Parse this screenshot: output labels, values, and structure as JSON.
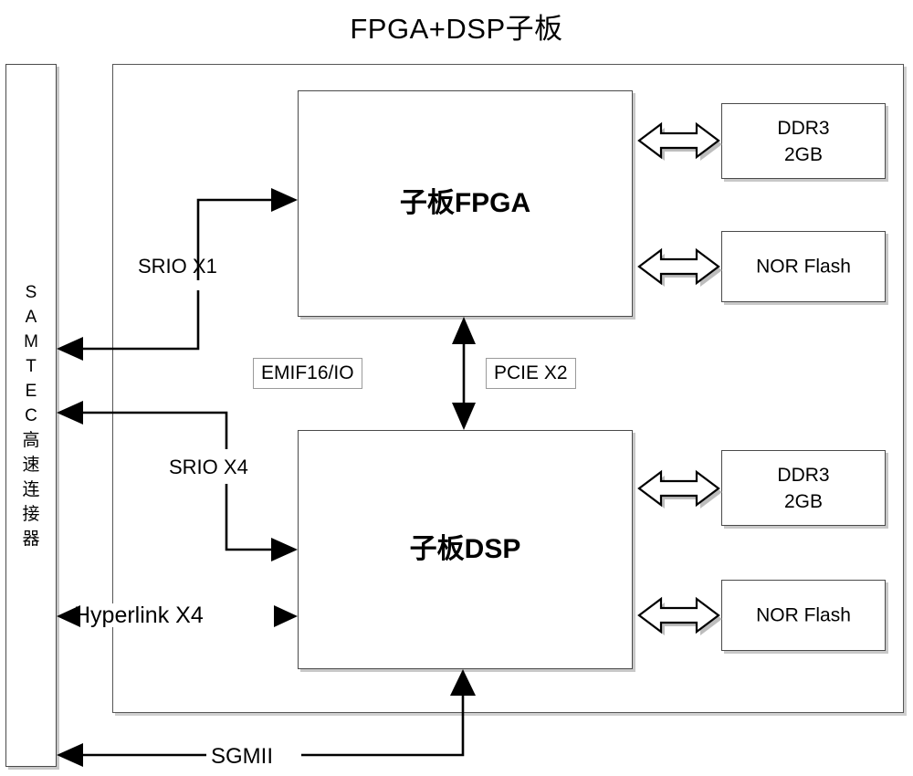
{
  "title": "FPGA+DSP子板",
  "connector": {
    "name": "samtec-connector",
    "label": "S\nA\nM\nT\nE\nC\n高\n速\n连\n接\n器"
  },
  "blocks": {
    "fpga": {
      "label": "子板FPGA"
    },
    "dsp": {
      "label": "子板DSP"
    },
    "fpga_ddr3": {
      "label": "DDR3\n2GB"
    },
    "fpga_nor": {
      "label": "NOR Flash"
    },
    "dsp_ddr3": {
      "label": "DDR3\n2GB"
    },
    "dsp_nor": {
      "label": "NOR Flash"
    }
  },
  "bus_tags": {
    "emif": "EMIF16/IO",
    "pcie": "PCIE X2"
  },
  "wire_labels": {
    "srio_x1": "SRIO X1",
    "srio_x4": "SRIO X4",
    "hyperlink_x4": "Hyperlink X4",
    "sgmii": "SGMII"
  },
  "colors": {
    "line": "#000000",
    "box_border": "#4a4a4a",
    "box_shadow": "#c8c8c8",
    "tag_border": "#9a9a9a",
    "background": "#ffffff"
  }
}
